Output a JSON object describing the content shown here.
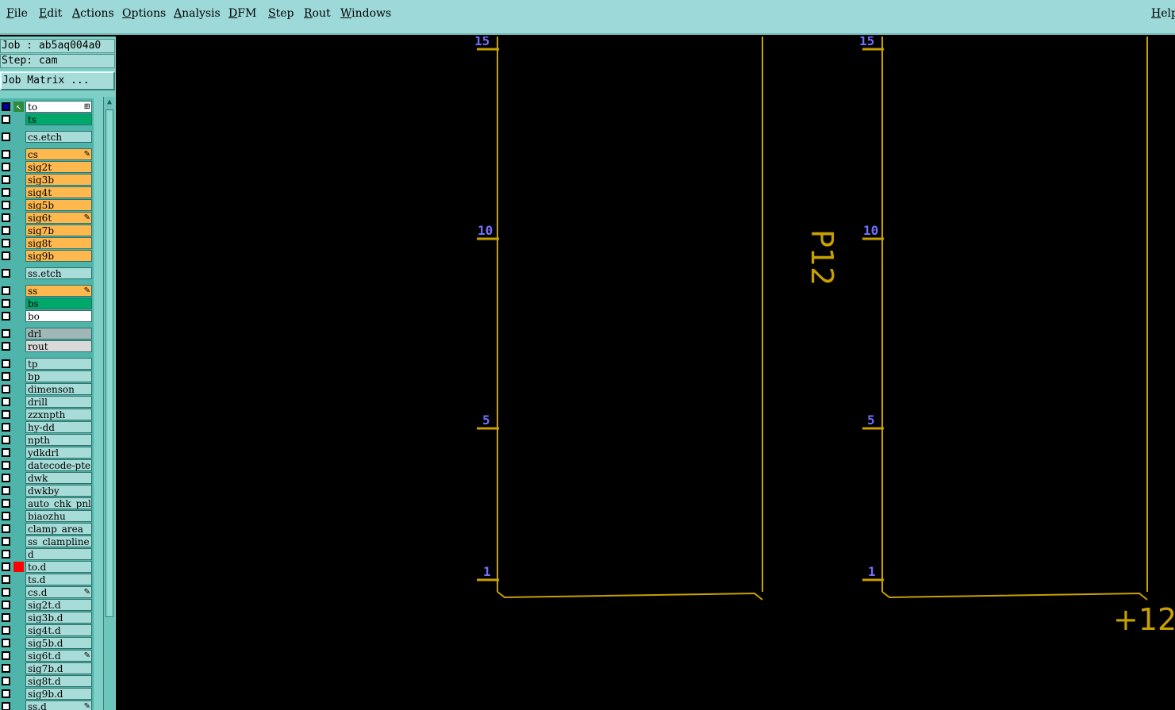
{
  "menu": {
    "items": [
      "File",
      "Edit",
      "Actions",
      "Options",
      "Analysis",
      "DFM",
      "Step",
      "Rout",
      "Windows"
    ],
    "help": "Help"
  },
  "panel": {
    "job": "Job : ab5aq004a0",
    "step": "Step: cam",
    "matrix_button": "Job Matrix ...",
    "layers": [
      {
        "name": "to",
        "color": "#ffffff",
        "mark": "⊞",
        "active": true
      },
      {
        "name": "ts",
        "color": "#00a86b"
      },
      {
        "name": "cs.etch",
        "color": "#a7dcd8"
      },
      {
        "name": "cs",
        "color": "#ffb84d",
        "mark": "✎"
      },
      {
        "name": "sig2t",
        "color": "#ffb84d"
      },
      {
        "name": "sig3b",
        "color": "#ffb84d"
      },
      {
        "name": "sig4t",
        "color": "#ffb84d"
      },
      {
        "name": "sig5b",
        "color": "#ffb84d"
      },
      {
        "name": "sig6t",
        "color": "#ffb84d",
        "mark": "✎"
      },
      {
        "name": "sig7b",
        "color": "#ffb84d"
      },
      {
        "name": "sig8t",
        "color": "#ffb84d"
      },
      {
        "name": "sig9b",
        "color": "#ffb84d"
      },
      {
        "name": "ss.etch",
        "color": "#a7dcd8"
      },
      {
        "name": "ss",
        "color": "#ffb84d",
        "mark": "✎"
      },
      {
        "name": "bs",
        "color": "#00a86b"
      },
      {
        "name": "bo",
        "color": "#ffffff"
      },
      {
        "name": "drl",
        "color": "#9fb7b7"
      },
      {
        "name": "rout",
        "color": "#d9d9d9"
      },
      {
        "name": "tp",
        "color": "#a7dcd8"
      },
      {
        "name": "bp",
        "color": "#a7dcd8"
      },
      {
        "name": "dimenson",
        "color": "#a7dcd8"
      },
      {
        "name": "drill",
        "color": "#a7dcd8"
      },
      {
        "name": "zzxnpth",
        "color": "#a7dcd8"
      },
      {
        "name": "hy-dd",
        "color": "#a7dcd8"
      },
      {
        "name": "npth",
        "color": "#a7dcd8"
      },
      {
        "name": "ydkdrl",
        "color": "#a7dcd8"
      },
      {
        "name": "datecode-pte",
        "color": "#a7dcd8"
      },
      {
        "name": "dwk",
        "color": "#a7dcd8"
      },
      {
        "name": "dwkby",
        "color": "#a7dcd8"
      },
      {
        "name": "auto_chk_pnl",
        "color": "#a7dcd8"
      },
      {
        "name": "biaozhu",
        "color": "#a7dcd8"
      },
      {
        "name": "clamp_area",
        "color": "#a7dcd8"
      },
      {
        "name": "ss_clampline",
        "color": "#a7dcd8"
      },
      {
        "name": "d",
        "color": "#a7dcd8"
      },
      {
        "name": "to.d",
        "color": "#a7dcd8",
        "swatch": "#ff0000"
      },
      {
        "name": "ts.d",
        "color": "#a7dcd8"
      },
      {
        "name": "cs.d",
        "color": "#a7dcd8",
        "mark": "✎"
      },
      {
        "name": "sig2t.d",
        "color": "#a7dcd8"
      },
      {
        "name": "sig3b.d",
        "color": "#a7dcd8"
      },
      {
        "name": "sig4t.d",
        "color": "#a7dcd8"
      },
      {
        "name": "sig5b.d",
        "color": "#a7dcd8"
      },
      {
        "name": "sig6t.d",
        "color": "#a7dcd8",
        "mark": "✎"
      },
      {
        "name": "sig7b.d",
        "color": "#a7dcd8"
      },
      {
        "name": "sig8t.d",
        "color": "#a7dcd8"
      },
      {
        "name": "sig9b.d",
        "color": "#a7dcd8"
      },
      {
        "name": "ss.d",
        "color": "#a7dcd8",
        "mark": "✎"
      }
    ]
  },
  "canvas": {
    "ticks": [
      "15",
      "10",
      "5",
      "1"
    ],
    "part_label": "P12",
    "corner_label": "+12",
    "colors": {
      "outline": "#c8a000",
      "tick_label": "#7070ff",
      "text": "#c8a000"
    }
  }
}
